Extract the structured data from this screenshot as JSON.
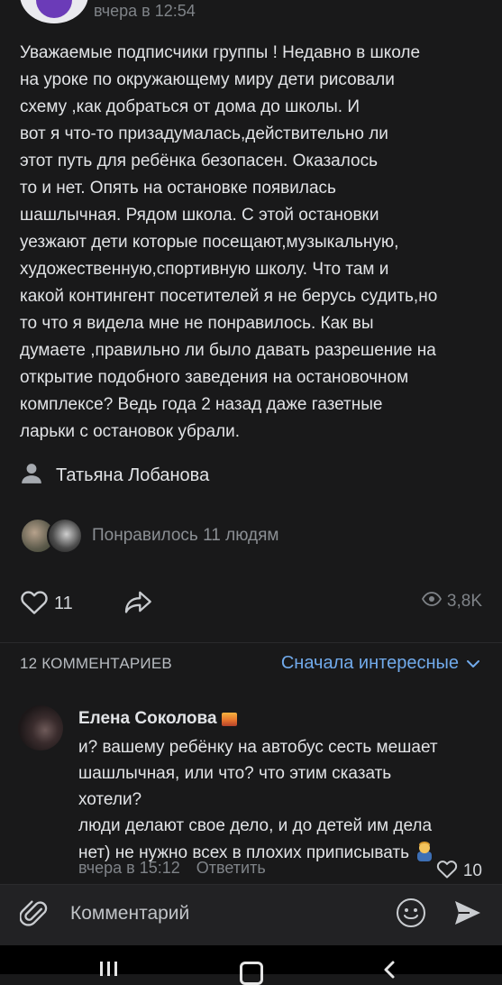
{
  "post": {
    "time": "вчера в 12:54",
    "text": "Уважаемые подписчики группы ! Недавно в школе\nна уроке по окружающему миру дети рисовали\nсхему ,как добраться от дома до школы.   И\nвот я что-то призадумалась,действительно ли\nэтот путь для ребёнка безопасен. Оказалось\nто и нет. Опять на остановке появилась\nшашлычная. Рядом школа. С этой остановки\nуезжают дети которые посещают,музыкальную,\nхудожественную,спортивную школу. Что там и\nкакой контингент посетителей я не берусь судить,но\nто что я видела мне не понравилось. Как вы\nдумаете ,правильно ли было давать разрешение на\nоткрытие подобного заведения на остановочном\nкомплексе? Ведь года 2 назад  даже газетные\nларьки с остановок убрали.",
    "author": "Татьяна Лобанова",
    "liked_by": "Понравилось 11 людям",
    "like_count": "11",
    "views": "3,8K"
  },
  "comments": {
    "header": "12 КОММЕНТАРИЕВ",
    "sort_label": "Сначала интересные",
    "items": [
      {
        "name": "Елена Соколова",
        "text": "и? вашему ребёнку на автобус сесть мешает\nшашлычная, или что? что этим сказать\nхотели?\nлюди делают свое дело, и до детей им дела\nнет) не нужно всех в плохих приписывать",
        "time": "вчера в 15:12",
        "reply_label": "Ответить",
        "likes": "10"
      }
    ]
  },
  "input": {
    "placeholder": "Комментарий"
  },
  "colors": {
    "background": "#19191a",
    "accent": "#71aaeb",
    "muted": "#7f8388",
    "text": "#e1e3e6"
  }
}
